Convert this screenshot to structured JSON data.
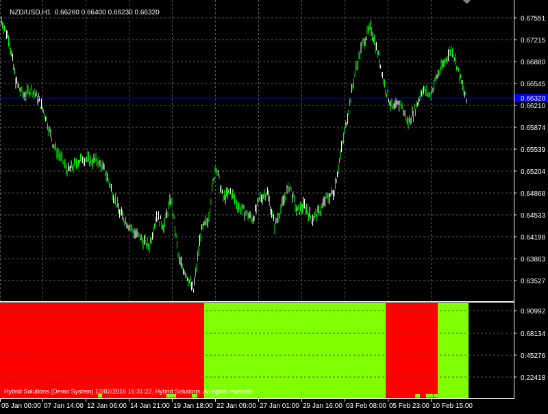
{
  "header": {
    "symbol": "NZD/USD,H1",
    "open": "0.66260",
    "high": "0.66400",
    "low": "0.66230",
    "close": "0.66320"
  },
  "price_axis": {
    "ticks": [
      "0.67551",
      "0.67215",
      "0.66880",
      "0.66545",
      "0.66210",
      "0.65874",
      "0.65539",
      "0.65204",
      "0.64868",
      "0.64533",
      "0.64198",
      "0.63863",
      "0.63527"
    ],
    "current_price": "0.66320"
  },
  "indicator_axis": {
    "ticks": [
      "0.90992",
      "0.68134",
      "0.45276",
      "0.22418"
    ]
  },
  "time_axis": {
    "labels": [
      "05 Jan 00:00",
      "07 Jan 14:00",
      "12 Jan 06:00",
      "14 Jan 21:00",
      "19 Jan 18:00",
      "22 Jan 09:00",
      "27 Jan 01:00",
      "29 Jan 16:00",
      "03 Feb 08:00",
      "05 Feb 23:00",
      "10 Feb 15:00"
    ]
  },
  "copyright": "Hybrid Solutions (Demo System) 12/02/2016 16:31:22, Hybrid Solutions. All rights reserved.",
  "colors": {
    "background": "#000000",
    "candle": "#00ff00",
    "candle_alt": "#ffffff",
    "grid": "#5a5a5a",
    "price_line": "#0000ff",
    "up_zone": "#7fff00",
    "down_zone": "#ff0000",
    "axis_text": "#ffffff"
  },
  "chart_data": [
    {
      "type": "line",
      "title": "NZD/USD,H1",
      "ylim": [
        0.634,
        0.678
      ],
      "x": [
        "05 Jan 00:00",
        "07 Jan 14:00",
        "12 Jan 06:00",
        "14 Jan 21:00",
        "19 Jan 18:00",
        "22 Jan 09:00",
        "27 Jan 01:00",
        "29 Jan 16:00",
        "03 Feb 08:00",
        "05 Feb 23:00",
        "10 Feb 15:00"
      ],
      "series": [
        {
          "values": [
            0.675,
            0.6725,
            0.666,
            0.664,
            0.665,
            0.6635,
            0.661,
            0.657,
            0.655,
            0.653,
            0.654,
            0.655,
            0.6545,
            0.6545,
            0.653,
            0.65,
            0.647,
            0.6455,
            0.644,
            0.643,
            0.642,
            0.6465,
            0.645,
            0.649,
            0.64,
            0.638,
            0.6355,
            0.644,
            0.646,
            0.654,
            0.649,
            0.65,
            0.648,
            0.647,
            0.646,
            0.649,
            0.65,
            0.645,
            0.648,
            0.651,
            0.647,
            0.648,
            0.646,
            0.647,
            0.649,
            0.65,
            0.656,
            0.662,
            0.668,
            0.672,
            0.674,
            0.67,
            0.665,
            0.662,
            0.663,
            0.66,
            0.662,
            0.665,
            0.664,
            0.667,
            0.669,
            0.671,
            0.667,
            0.6632
          ]
        }
      ]
    },
    {
      "type": "bar",
      "ylim": [
        0,
        1.0
      ],
      "segments": [
        {
          "state": "down",
          "value": 1.0
        },
        {
          "state": "up",
          "value": 1.0
        },
        {
          "state": "down",
          "value": 1.0
        },
        {
          "state": "up",
          "value": 1.0
        }
      ]
    }
  ]
}
